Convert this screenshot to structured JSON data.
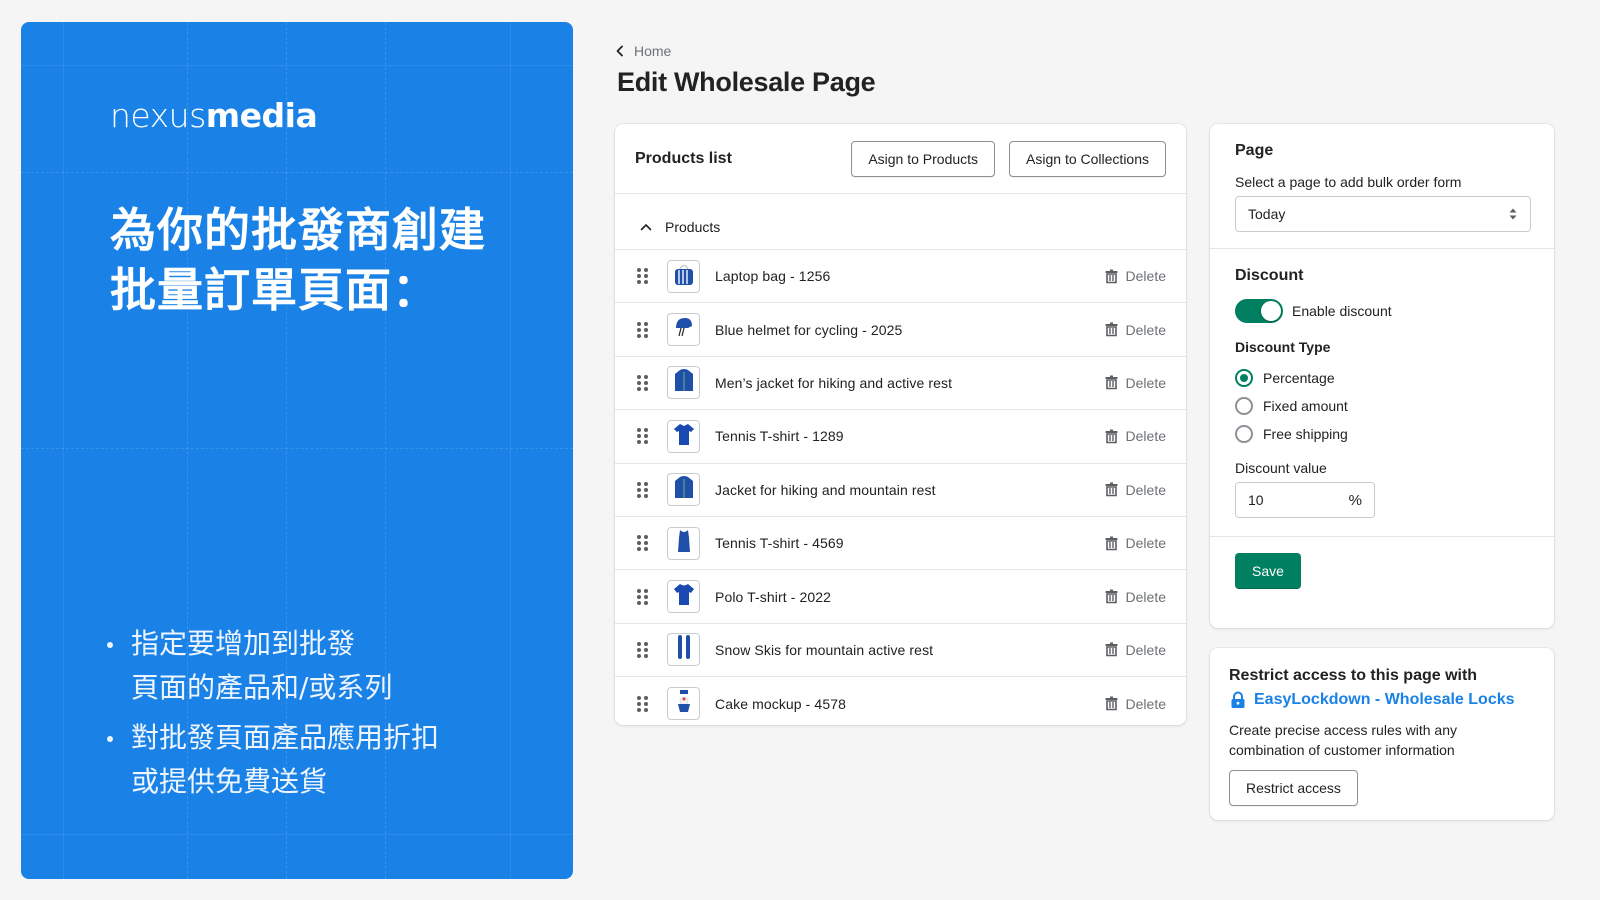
{
  "promo": {
    "logo_light": "nexus",
    "logo_bold": "media",
    "headline_line1": "為你的批發商創建",
    "headline_line2": "批量訂單頁面：",
    "bullets": [
      {
        "line1": "指定要增加到批發",
        "line2": "頁面的產品和/或系列"
      },
      {
        "line1": "對批發頁面產品應用折扣",
        "line2": "或提供免費送貨"
      }
    ],
    "background_color": "#1a82e6"
  },
  "header": {
    "breadcrumb": "Home",
    "breadcrumb_icon": "chevron-left-icon",
    "title": "Edit Wholesale Page"
  },
  "products_card": {
    "title": "Products list",
    "assign_products_label": "Asign to Products",
    "assign_collections_label": "Asign to Collections",
    "section_label": "Products",
    "delete_label": "Delete",
    "items": [
      {
        "name": "Laptop bag - 1256",
        "thumb": "bag"
      },
      {
        "name": "Blue helmet for cycling - 2025",
        "thumb": "helmet"
      },
      {
        "name": "Men’s jacket for hiking and active rest",
        "thumb": "jacket"
      },
      {
        "name": "Tennis T-shirt - 1289",
        "thumb": "polo"
      },
      {
        "name": "Jacket for hiking and mountain rest",
        "thumb": "jacket"
      },
      {
        "name": "Tennis T-shirt - 4569",
        "thumb": "tank"
      },
      {
        "name": "Polo T-shirt - 2022",
        "thumb": "tshirt"
      },
      {
        "name": "Snow Skis for mountain active rest",
        "thumb": "skis"
      },
      {
        "name": "Cake mockup - 4578",
        "thumb": "cake"
      }
    ]
  },
  "settings_card": {
    "page_title": "Page",
    "page_label": "Select a page to add bulk order form",
    "page_selected": "Today",
    "discount_title": "Discount",
    "enable_discount_label": "Enable discount",
    "enable_discount_on": true,
    "discount_type_title": "Discount Type",
    "discount_types": [
      {
        "label": "Percentage",
        "selected": true
      },
      {
        "label": "Fixed amount",
        "selected": false
      },
      {
        "label": "Free shipping",
        "selected": false
      }
    ],
    "discount_value_label": "Discount value",
    "discount_value": "10",
    "discount_value_suffix": "%",
    "save_label": "Save",
    "accent_color": "#008060"
  },
  "restrict_card": {
    "title": "Restrict access to this page with",
    "link_label": "EasyLockdown - Wholesale Locks",
    "description": "Create precise access rules with any combination of customer information",
    "button_label": "Restrict access",
    "link_color": "#1a82e6"
  }
}
